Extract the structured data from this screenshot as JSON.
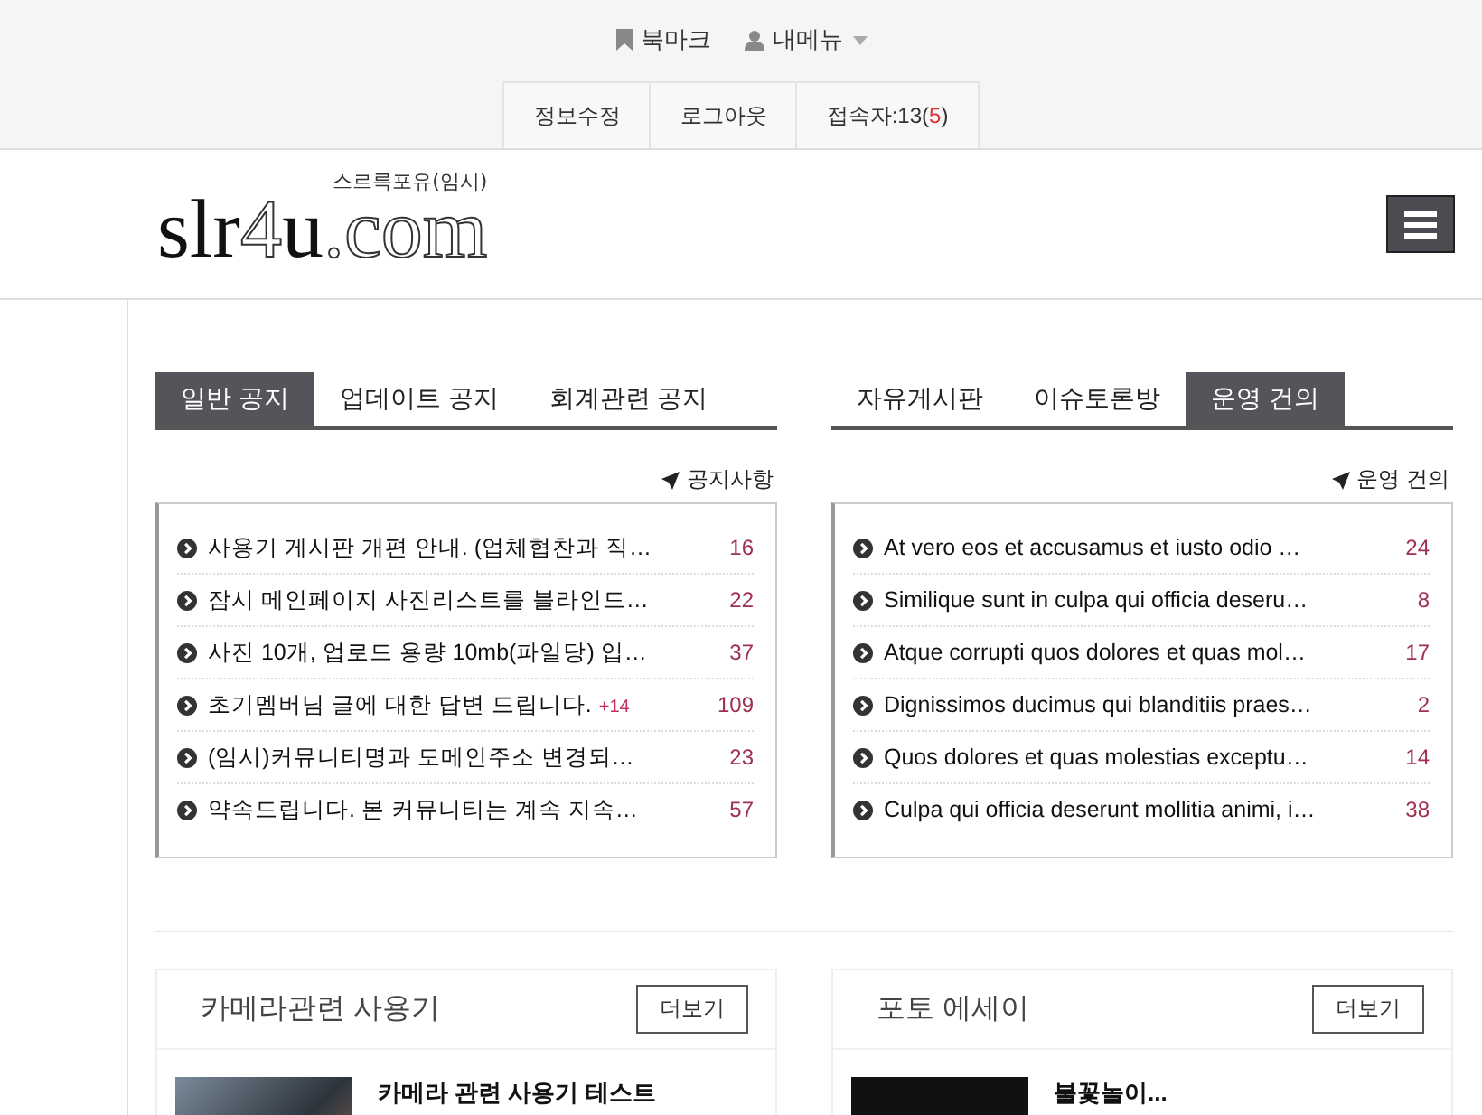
{
  "top_links": [
    {
      "kind": "bookmark",
      "label": "북마크"
    },
    {
      "kind": "user",
      "label": "내메뉴"
    }
  ],
  "top_tabs": [
    {
      "kind": "plain",
      "label": "정보수정"
    },
    {
      "kind": "plain",
      "label": "로그아웃"
    },
    {
      "kind": "counter",
      "label": "접속자:13(",
      "highlight": "5",
      "suffix": ")"
    }
  ],
  "logo": {
    "parts": [
      {
        "text": "slr",
        "outlined": false
      },
      {
        "text": "4",
        "outlined": true
      },
      {
        "text": "u",
        "outlined": false
      },
      {
        "text": ".com",
        "outlined": true
      }
    ],
    "tagline": "스르륵포유(임시)"
  },
  "panels": [
    {
      "tabs": [
        {
          "label": "일반 공지",
          "selected": true
        },
        {
          "label": "업데이트 공지",
          "selected": false
        },
        {
          "label": "회계관련 공지",
          "selected": false
        }
      ],
      "link": "공지사항",
      "rows": [
        {
          "title": "사용기 게시판 개편 안내. (업체협찬과 직…",
          "count": "16"
        },
        {
          "title": "잠시 메인페이지 사진리스트를 블라인드…",
          "count": "22"
        },
        {
          "title": "사진 10개, 업로드 용량 10mb(파일당) 입…",
          "count": "37"
        },
        {
          "title": "초기멤버님 글에 대한 답변 드립니다.",
          "comments": "+14",
          "count": "109"
        },
        {
          "title": "(임시)커뮤니티명과 도메인주소 변경되…",
          "count": "23"
        },
        {
          "title": "약속드립니다. 본 커뮤니티는 계속 지속…",
          "count": "57"
        }
      ]
    },
    {
      "tabs": [
        {
          "label": "자유게시판",
          "selected": false
        },
        {
          "label": "이슈토론방",
          "selected": false
        },
        {
          "label": "운영 건의",
          "selected": true
        }
      ],
      "link": "운영 건의",
      "rows": [
        {
          "title": "At vero eos et accusamus et iusto odio …",
          "count": "24"
        },
        {
          "title": "Similique sunt in culpa qui officia deseru…",
          "count": "8"
        },
        {
          "title": "Atque corrupti quos dolores et quas mol…",
          "count": "17"
        },
        {
          "title": "Dignissimos ducimus qui blanditiis praes…",
          "count": "2"
        },
        {
          "title": "Quos dolores et quas molestias exceptu…",
          "count": "14"
        },
        {
          "title": "Culpa qui officia deserunt mollitia animi, i…",
          "count": "38"
        }
      ]
    }
  ],
  "cards": [
    {
      "title": "카메라관련 사용기",
      "more": "더보기",
      "post_title": "카메라 관련 사용기 테스트"
    },
    {
      "title": "포토 에세이",
      "more": "더보기",
      "post_title": "불꽃놀이..."
    }
  ]
}
